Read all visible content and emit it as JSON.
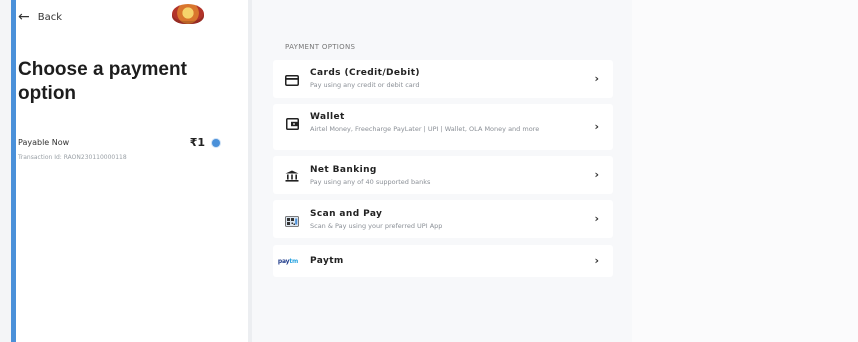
{
  "header": {
    "back_label": "Back"
  },
  "summary": {
    "title": "Choose a payment option",
    "payable_label": "Payable Now",
    "amount": "₹1",
    "transaction_id": "Transaction Id: RAON230110000118"
  },
  "payment_options": {
    "heading": "PAYMENT OPTIONS",
    "items": [
      {
        "icon": "card-icon",
        "title": "Cards (Credit/Debit)",
        "description": "Pay using any credit or debit card"
      },
      {
        "icon": "wallet-icon",
        "title": "Wallet",
        "description": "Airtel Money, Freecharge PayLater | UPI | Wallet, OLA Money and more"
      },
      {
        "icon": "bank-icon",
        "title": "Net Banking",
        "description": "Pay using any of 40 supported banks"
      },
      {
        "icon": "qr-code-icon",
        "title": "Scan and Pay",
        "description": "Scan & Pay using your preferred UPI App"
      },
      {
        "icon": "paytm-logo-icon",
        "title": "Paytm",
        "description": ""
      }
    ]
  },
  "colors": {
    "accent": "#4a90d9"
  }
}
